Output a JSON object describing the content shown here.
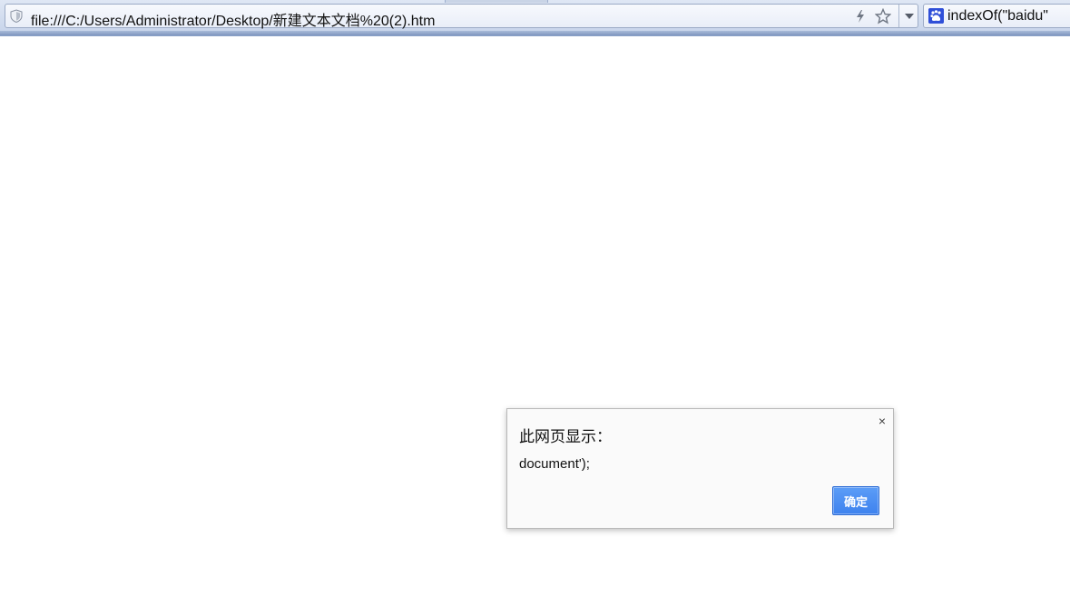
{
  "browser": {
    "address_bar": {
      "url": "file:///C:/Users/Administrator/Desktop/新建文本文档%20(2).htm"
    },
    "search_box": {
      "engine_icon": "baidu-paw-icon",
      "text": "indexOf(\"baidu\""
    },
    "icons": {
      "security": "shield-icon",
      "speed_mode": "lightning-icon",
      "favorite": "star-icon",
      "history_dropdown": "chevron-down-icon"
    }
  },
  "dialog": {
    "title": "此网页显示：",
    "message": "document');",
    "ok_label": "确定",
    "close_glyph": "×"
  },
  "colors": {
    "ok_button": "#4a8ef2",
    "toolbar": "#c6d3ea",
    "search_engine_icon": "#2f4fd8"
  }
}
